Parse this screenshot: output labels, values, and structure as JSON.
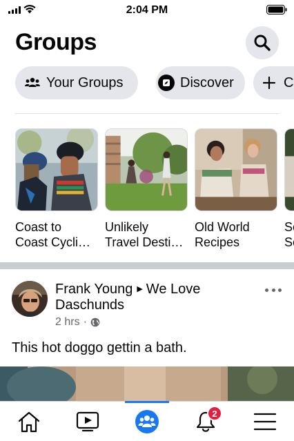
{
  "status_bar": {
    "time": "2:04 PM"
  },
  "header": {
    "title": "Groups"
  },
  "chips": [
    {
      "label": "Your Groups",
      "icon": "people-icon"
    },
    {
      "label": "Discover",
      "icon": "discover-icon"
    },
    {
      "label": "C",
      "icon": "plus-icon"
    }
  ],
  "group_cards": [
    {
      "label": "Coast to\nCoast Cycli…"
    },
    {
      "label": "Unlikely\nTravel Desti…"
    },
    {
      "label": "Old World\nRecipes"
    },
    {
      "label": "So\nSe"
    }
  ],
  "post": {
    "author": "Frank Young",
    "group": "We Love Daschunds",
    "time": "2 hrs",
    "separator": "·",
    "privacy_icon": "globe-icon",
    "text": "This hot doggo gettin a bath."
  },
  "bottom_nav": {
    "items": [
      "home-icon",
      "watch-icon",
      "groups-icon",
      "notifications-icon",
      "menu-icon"
    ],
    "active": "groups",
    "notification_count": "2"
  },
  "colors": {
    "accent": "#1877f2",
    "badge": "#e41e3f",
    "chip_bg": "#e4e6eb",
    "secondary_text": "#65676b"
  }
}
